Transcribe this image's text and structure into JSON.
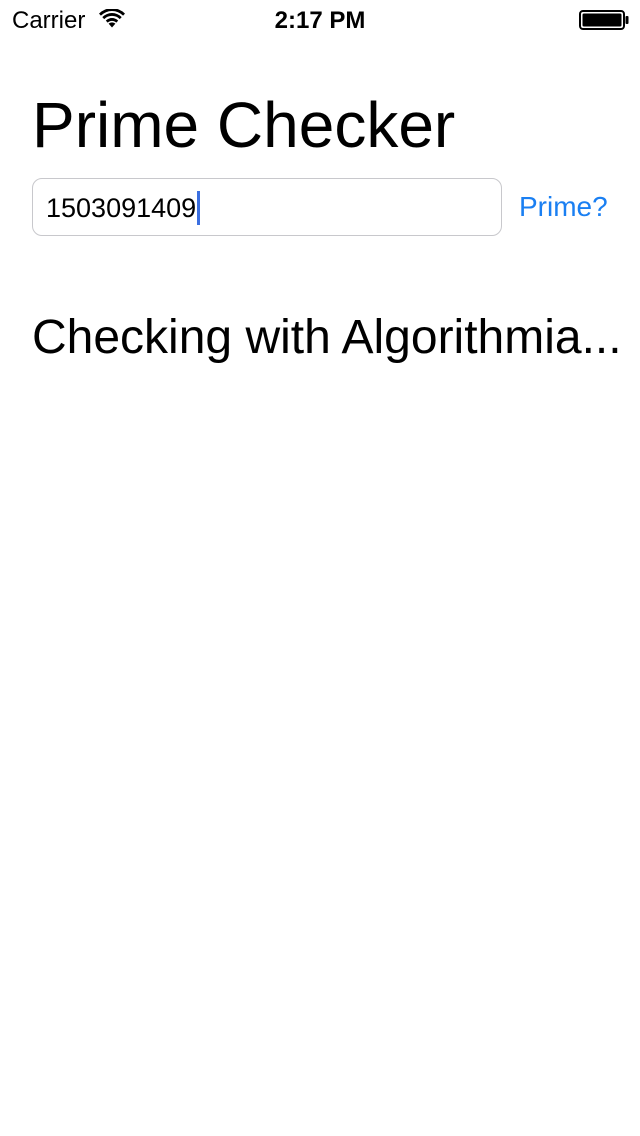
{
  "status_bar": {
    "carrier": "Carrier",
    "time": "2:17 PM",
    "wifi_icon": "wifi-icon",
    "battery_icon": "battery-icon"
  },
  "main": {
    "title": "Prime Checker",
    "number_input": {
      "value": "1503091409",
      "placeholder": ""
    },
    "check_button_label": "Prime?",
    "result_text": "Checking with Algorithmia...",
    "accent_color": "#1a7ff2",
    "caret_color": "#3b6fe0"
  }
}
